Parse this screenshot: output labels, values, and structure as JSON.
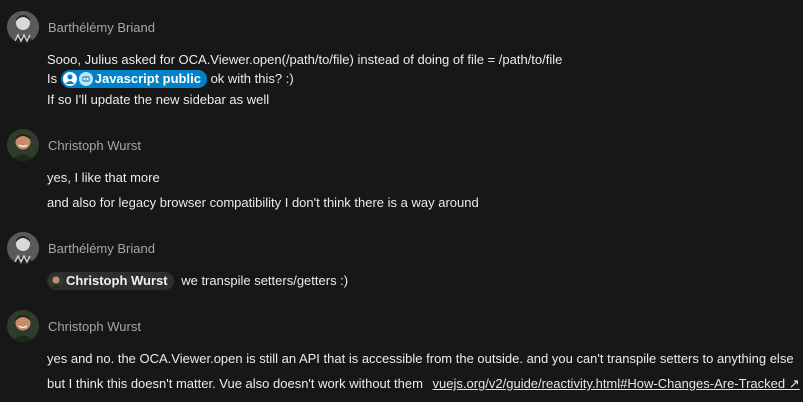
{
  "messages": [
    {
      "author": "Barthélémy Briand",
      "lines": [
        "Sooo, Julius asked for OCA.Viewer.open(/path/to/file) instead of doing of file = /path/to/file",
        {
          "prefix": "Is ",
          "mention": "Javascript public",
          "suffix": "ok with this? :)"
        },
        "If so I'll update the new sidebar as well"
      ]
    },
    {
      "author": "Christoph Wurst",
      "lines": [
        "yes, I like that more",
        "and also for legacy browser compatibility I don't think there is a way around"
      ]
    },
    {
      "author": "Barthélémy Briand",
      "lines": [
        {
          "mention": "Christoph Wurst",
          "suffix": "we transpile setters/getters :)"
        }
      ]
    },
    {
      "author": "Christoph Wurst",
      "lines": [
        "yes and no. the OCA.Viewer.open is still an API that is accessible from the outside. and you can't transpile setters to anything else",
        {
          "text": "but I think this doesn't matter. Vue also doesn't work without them",
          "link": "vuejs.org/v2/guide/reactivity.html#How-Changes-Are-Tracked ↗"
        }
      ]
    }
  ],
  "icons": {
    "team_mention": "group-icon",
    "team_avatar": "robot-icon"
  },
  "colors": {
    "team_chip": "#0082c9",
    "user_chip": "#2e2e2e",
    "background": "#171717"
  }
}
